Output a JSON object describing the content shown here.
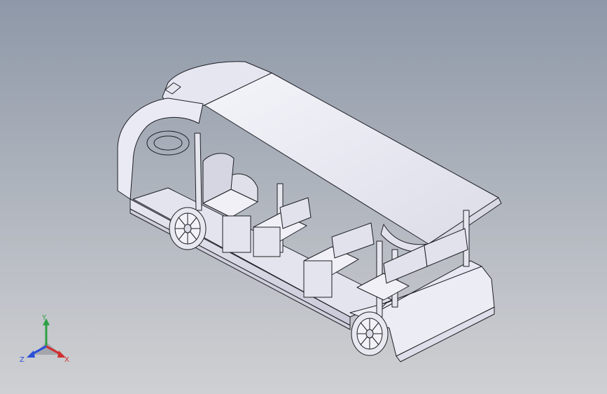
{
  "viewport": {
    "background_top": "#8e98a8",
    "background_bottom": "#cfd0d3"
  },
  "model": {
    "icon": "electric-shuttle-bus-3d-model",
    "body_color": "#eeeef6",
    "edge_color": "#1e1e24",
    "shadow_color": "#d6d6e2"
  },
  "triad": {
    "y_label": "Y",
    "x_label": "X",
    "z_label": "Z",
    "y_color": "#2ea043",
    "x_color": "#d03030",
    "z_color": "#2b4fd8"
  }
}
